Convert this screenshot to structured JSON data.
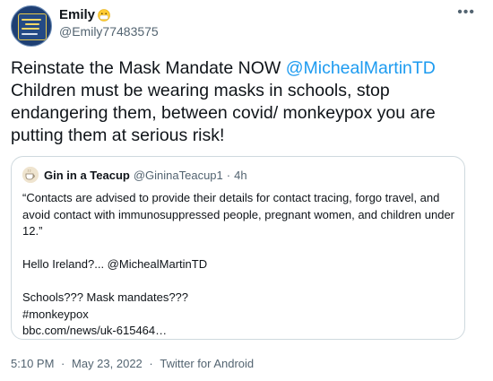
{
  "author": {
    "display_name": "Emily",
    "name_emoji": "mask-face-emoji",
    "handle": "@Emily77483575"
  },
  "more_icon": "more-options-icon",
  "tweet": {
    "text_part1": "Reinstate the Mask Mandate NOW ",
    "mention": "@MichealMartinTD",
    "text_part2": " Children must be wearing masks in schools, stop endangering them, between covid/ monkeypox you are putting them at serious risk!"
  },
  "quote": {
    "display_name": "Gin in a Teacup",
    "handle": "@GininaTeacup1",
    "dot": "·",
    "time": "4h",
    "line1": "“Contacts are advised to provide their details for contact tracing, forgo travel, and avoid contact with immunosuppressed people, pregnant women, and children under 12.”",
    "line2": "Hello Ireland?... @MichealMartinTD",
    "line3": "Schools??? Mask mandates???",
    "line4": "#monkeypox",
    "line5": "bbc.com/news/uk-615464…"
  },
  "footer": {
    "time": "5:10 PM",
    "sep1": "·",
    "date": "May 23, 2022",
    "sep2": "·",
    "source": "Twitter for Android"
  },
  "colors": {
    "link": "#1d9bf0",
    "text": "#0f1419",
    "secondary": "#536471",
    "border": "#cfd9de"
  }
}
